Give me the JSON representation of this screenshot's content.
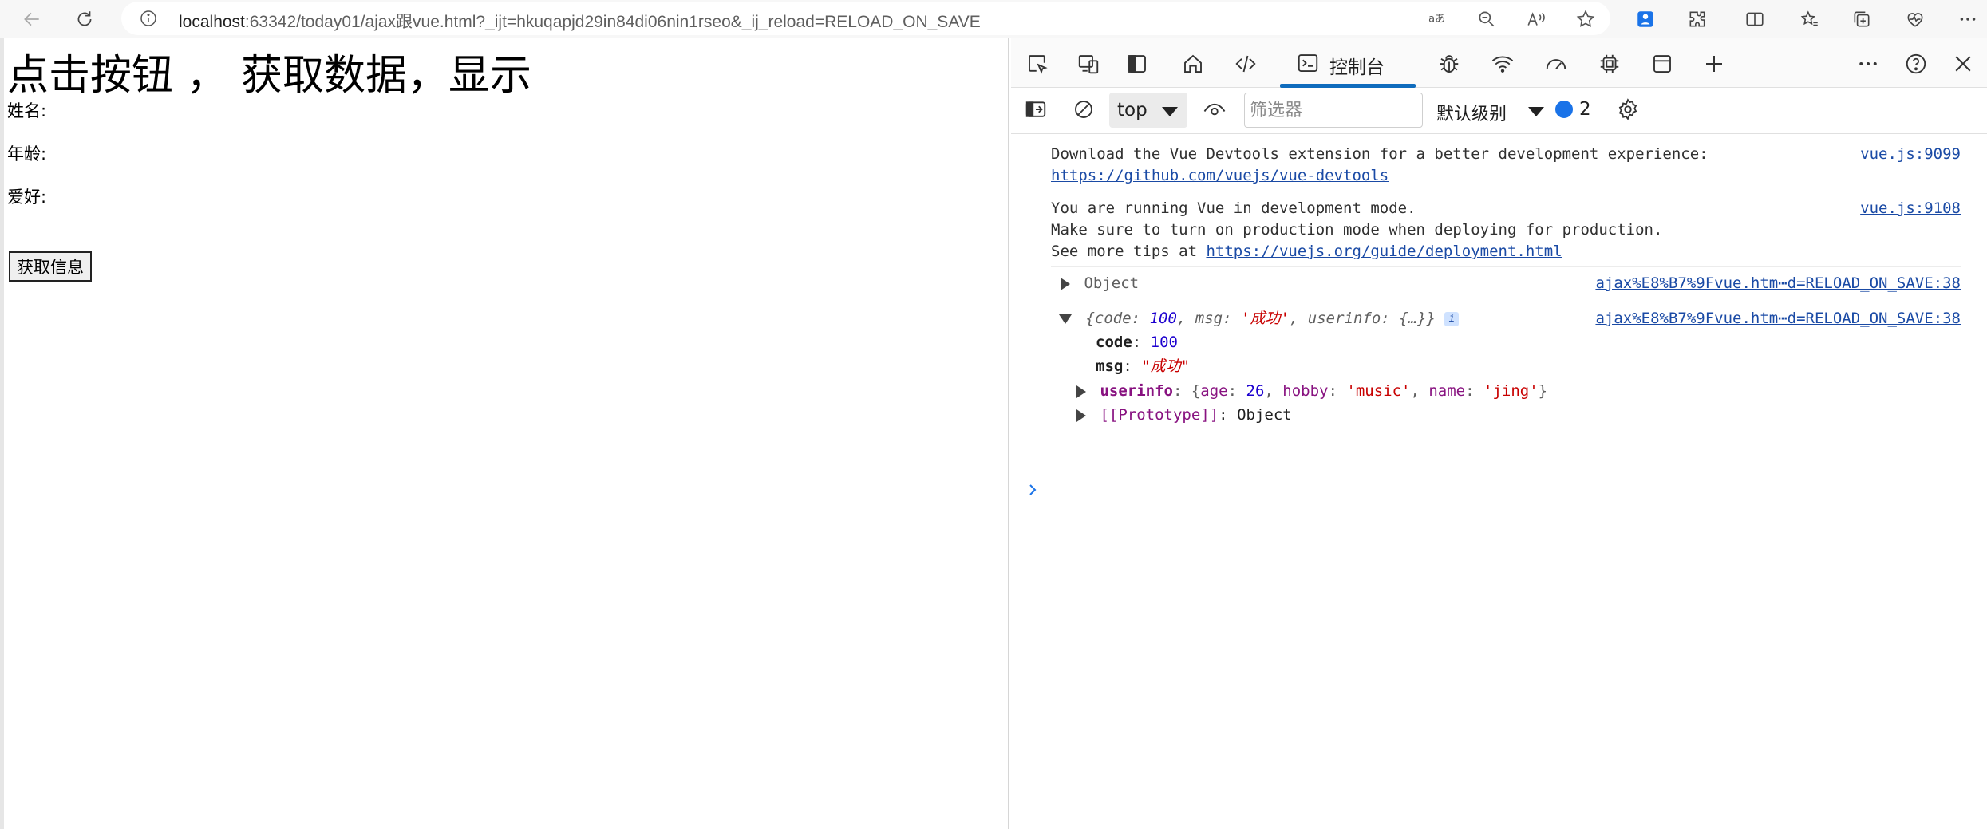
{
  "browser": {
    "url_host": "localhost",
    "url_rest": ":63342/today01/ajax跟vue.html?_ijt=hkuqapjd29in84di06nin1rseo&_ij_reload=RELOAD_ON_SAVE"
  },
  "page": {
    "heading": "点击按钮 ， 获取数据，显示",
    "name_label": "姓名:",
    "age_label": "年龄:",
    "hobby_label": "爱好:",
    "button_label": "获取信息"
  },
  "devtools": {
    "console_tab_label": "控制台",
    "context_value": "top",
    "filter_placeholder": "筛选器",
    "level_label": "默认级别",
    "issues_count": "2",
    "messages": {
      "m1_line1": "Download the Vue Devtools extension for a better development experience:",
      "m1_link": "https://github.com/vuejs/vue-devtools",
      "m1_src": "vue.js:9099",
      "m2_line1": "You are running Vue in development mode.",
      "m2_line2": "Make sure to turn on production mode when deploying for production.",
      "m2_line3_prefix": "See more tips at ",
      "m2_link": "https://vuejs.org/guide/deployment.html",
      "m2_src": "vue.js:9108",
      "m3_text": "Object",
      "m3_src": "ajax%E8%B7%9Fvue.htm⋯d=RELOAD_ON_SAVE:38",
      "m4_summary_code_key": "code",
      "m4_summary_code_val": "100",
      "m4_summary_msg_key": "msg",
      "m4_summary_msg_val": "'成功'",
      "m4_summary_userinfo_key": "userinfo",
      "m4_summary_userinfo_val": "{…}",
      "m4_src": "ajax%E8%B7%9Fvue.htm⋯d=RELOAD_ON_SAVE:38",
      "code_key": "code",
      "code_val": "100",
      "msg_key": "msg",
      "msg_val": "\"成功\"",
      "userinfo_key": "userinfo",
      "userinfo_age_key": "age",
      "userinfo_age_val": "26",
      "userinfo_hobby_key": "hobby",
      "userinfo_hobby_val": "'music'",
      "userinfo_name_key": "name",
      "userinfo_name_val": "'jing'",
      "prototype_key": "[[Prototype]]",
      "prototype_val": "Object"
    }
  }
}
